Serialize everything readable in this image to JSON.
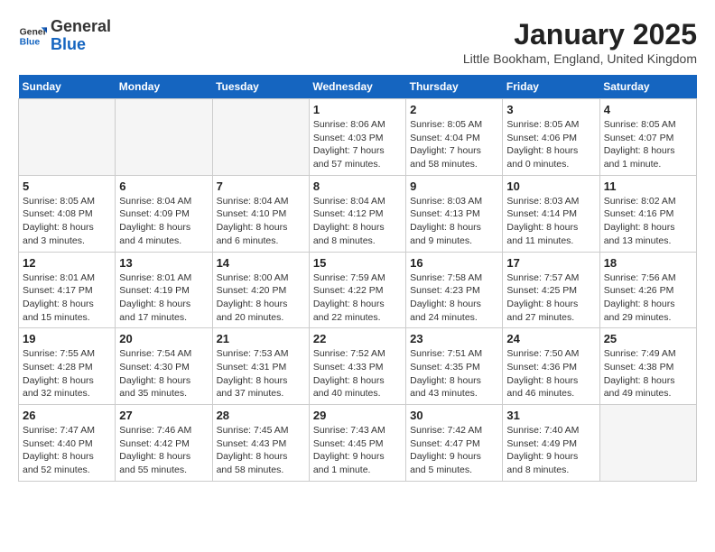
{
  "logo": {
    "general": "General",
    "blue": "Blue"
  },
  "title": "January 2025",
  "subtitle": "Little Bookham, England, United Kingdom",
  "days_of_week": [
    "Sunday",
    "Monday",
    "Tuesday",
    "Wednesday",
    "Thursday",
    "Friday",
    "Saturday"
  ],
  "weeks": [
    [
      {
        "day": "",
        "info": ""
      },
      {
        "day": "",
        "info": ""
      },
      {
        "day": "",
        "info": ""
      },
      {
        "day": "1",
        "info": "Sunrise: 8:06 AM\nSunset: 4:03 PM\nDaylight: 7 hours and 57 minutes."
      },
      {
        "day": "2",
        "info": "Sunrise: 8:05 AM\nSunset: 4:04 PM\nDaylight: 7 hours and 58 minutes."
      },
      {
        "day": "3",
        "info": "Sunrise: 8:05 AM\nSunset: 4:06 PM\nDaylight: 8 hours and 0 minutes."
      },
      {
        "day": "4",
        "info": "Sunrise: 8:05 AM\nSunset: 4:07 PM\nDaylight: 8 hours and 1 minute."
      }
    ],
    [
      {
        "day": "5",
        "info": "Sunrise: 8:05 AM\nSunset: 4:08 PM\nDaylight: 8 hours and 3 minutes."
      },
      {
        "day": "6",
        "info": "Sunrise: 8:04 AM\nSunset: 4:09 PM\nDaylight: 8 hours and 4 minutes."
      },
      {
        "day": "7",
        "info": "Sunrise: 8:04 AM\nSunset: 4:10 PM\nDaylight: 8 hours and 6 minutes."
      },
      {
        "day": "8",
        "info": "Sunrise: 8:04 AM\nSunset: 4:12 PM\nDaylight: 8 hours and 8 minutes."
      },
      {
        "day": "9",
        "info": "Sunrise: 8:03 AM\nSunset: 4:13 PM\nDaylight: 8 hours and 9 minutes."
      },
      {
        "day": "10",
        "info": "Sunrise: 8:03 AM\nSunset: 4:14 PM\nDaylight: 8 hours and 11 minutes."
      },
      {
        "day": "11",
        "info": "Sunrise: 8:02 AM\nSunset: 4:16 PM\nDaylight: 8 hours and 13 minutes."
      }
    ],
    [
      {
        "day": "12",
        "info": "Sunrise: 8:01 AM\nSunset: 4:17 PM\nDaylight: 8 hours and 15 minutes."
      },
      {
        "day": "13",
        "info": "Sunrise: 8:01 AM\nSunset: 4:19 PM\nDaylight: 8 hours and 17 minutes."
      },
      {
        "day": "14",
        "info": "Sunrise: 8:00 AM\nSunset: 4:20 PM\nDaylight: 8 hours and 20 minutes."
      },
      {
        "day": "15",
        "info": "Sunrise: 7:59 AM\nSunset: 4:22 PM\nDaylight: 8 hours and 22 minutes."
      },
      {
        "day": "16",
        "info": "Sunrise: 7:58 AM\nSunset: 4:23 PM\nDaylight: 8 hours and 24 minutes."
      },
      {
        "day": "17",
        "info": "Sunrise: 7:57 AM\nSunset: 4:25 PM\nDaylight: 8 hours and 27 minutes."
      },
      {
        "day": "18",
        "info": "Sunrise: 7:56 AM\nSunset: 4:26 PM\nDaylight: 8 hours and 29 minutes."
      }
    ],
    [
      {
        "day": "19",
        "info": "Sunrise: 7:55 AM\nSunset: 4:28 PM\nDaylight: 8 hours and 32 minutes."
      },
      {
        "day": "20",
        "info": "Sunrise: 7:54 AM\nSunset: 4:30 PM\nDaylight: 8 hours and 35 minutes."
      },
      {
        "day": "21",
        "info": "Sunrise: 7:53 AM\nSunset: 4:31 PM\nDaylight: 8 hours and 37 minutes."
      },
      {
        "day": "22",
        "info": "Sunrise: 7:52 AM\nSunset: 4:33 PM\nDaylight: 8 hours and 40 minutes."
      },
      {
        "day": "23",
        "info": "Sunrise: 7:51 AM\nSunset: 4:35 PM\nDaylight: 8 hours and 43 minutes."
      },
      {
        "day": "24",
        "info": "Sunrise: 7:50 AM\nSunset: 4:36 PM\nDaylight: 8 hours and 46 minutes."
      },
      {
        "day": "25",
        "info": "Sunrise: 7:49 AM\nSunset: 4:38 PM\nDaylight: 8 hours and 49 minutes."
      }
    ],
    [
      {
        "day": "26",
        "info": "Sunrise: 7:47 AM\nSunset: 4:40 PM\nDaylight: 8 hours and 52 minutes."
      },
      {
        "day": "27",
        "info": "Sunrise: 7:46 AM\nSunset: 4:42 PM\nDaylight: 8 hours and 55 minutes."
      },
      {
        "day": "28",
        "info": "Sunrise: 7:45 AM\nSunset: 4:43 PM\nDaylight: 8 hours and 58 minutes."
      },
      {
        "day": "29",
        "info": "Sunrise: 7:43 AM\nSunset: 4:45 PM\nDaylight: 9 hours and 1 minute."
      },
      {
        "day": "30",
        "info": "Sunrise: 7:42 AM\nSunset: 4:47 PM\nDaylight: 9 hours and 5 minutes."
      },
      {
        "day": "31",
        "info": "Sunrise: 7:40 AM\nSunset: 4:49 PM\nDaylight: 9 hours and 8 minutes."
      },
      {
        "day": "",
        "info": ""
      }
    ]
  ]
}
